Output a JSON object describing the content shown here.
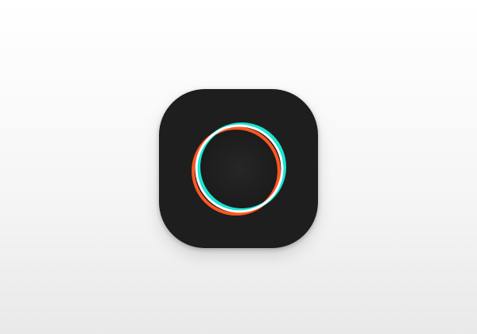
{
  "page": {
    "background": "#f3f3f3"
  },
  "app_icon": {
    "icon": "polarr-ring-icon",
    "tile_color": "#1e1e1e",
    "inner_color": "#202020",
    "ring_colors": {
      "orange": "#ff5722",
      "white": "#ffffff",
      "cyan": "#19e6d3"
    }
  }
}
